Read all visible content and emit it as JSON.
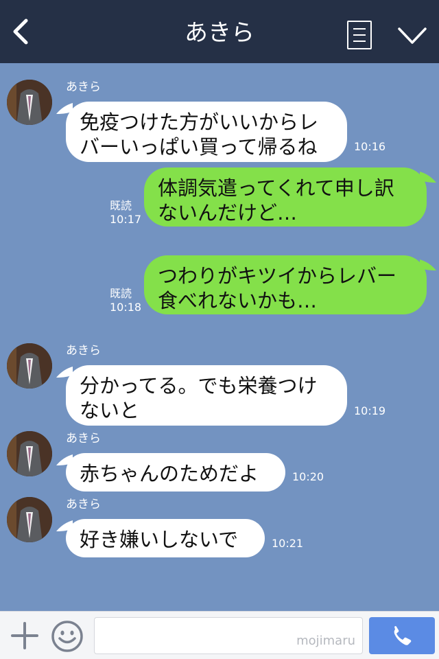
{
  "header": {
    "title": "あきら"
  },
  "messages": [
    {
      "dir": "in",
      "sender": "あきら",
      "lines": [
        "免疫つけた方がいいからレ",
        "バーいっぱい買って帰るね"
      ],
      "time": "10:16"
    },
    {
      "dir": "out",
      "read": "既読",
      "lines": [
        "体調気遣ってくれて申し訳",
        "ないんだけど…"
      ],
      "time": "10:17"
    },
    {
      "dir": "out",
      "read": "既読",
      "lines": [
        "つわりがキツイからレバー",
        "食べれないかも…"
      ],
      "time": "10:18"
    },
    {
      "dir": "in",
      "sender": "あきら",
      "lines": [
        "分かってる。でも栄養つけ",
        "ないと"
      ],
      "time": "10:19"
    },
    {
      "dir": "in",
      "sender": "あきら",
      "lines": [
        "赤ちゃんのためだよ"
      ],
      "time": "10:20"
    },
    {
      "dir": "in",
      "sender": "あきら",
      "lines": [
        "好き嫌いしないで"
      ],
      "time": "10:21"
    }
  ],
  "footer": {
    "watermark": "mojimaru"
  },
  "colors": {
    "header": "#253046",
    "background": "#7393c1",
    "incoming_bubble": "#ffffff",
    "outgoing_bubble": "#84e04a",
    "call_button": "#5b8be4"
  },
  "icons": [
    "back-chevron-icon",
    "menu-list-icon",
    "chevron-down-icon",
    "plus-icon",
    "smiley-icon",
    "phone-icon"
  ]
}
